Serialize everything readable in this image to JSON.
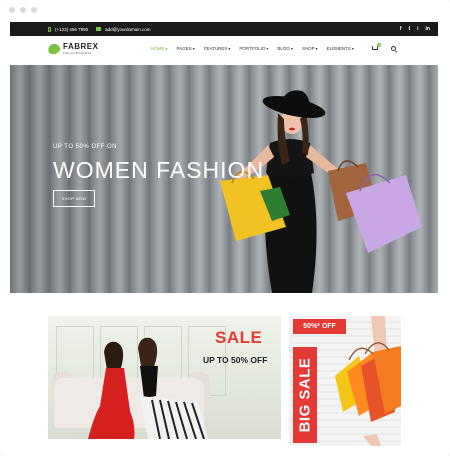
{
  "topbar": {
    "phone": "(+123) 456 7890",
    "email": "add@yourdomain.com",
    "socials": [
      "f",
      "t",
      "i",
      "in"
    ]
  },
  "logo": {
    "name": "FABREX",
    "tagline": "FOR ALL BUSINESS"
  },
  "nav": {
    "items": [
      {
        "label": "HOME",
        "active": true
      },
      {
        "label": "PAGES",
        "active": false
      },
      {
        "label": "FEATURES",
        "active": false
      },
      {
        "label": "PORTFOLIO",
        "active": false
      },
      {
        "label": "BLOG",
        "active": false
      },
      {
        "label": "SHOP",
        "active": false
      },
      {
        "label": "ELEMENTS",
        "active": false
      }
    ],
    "cart_count": "0"
  },
  "hero": {
    "subtitle": "UP TO 50% OFF ON",
    "title": "WOMEN FASHION",
    "button": "SHOP NOW"
  },
  "promo_sale": {
    "title": "SALE",
    "subtitle": "UP TO 50% OFF"
  },
  "promo_big": {
    "badge": "50%* OFF",
    "title": "BIG SALE"
  },
  "colors": {
    "accent": "#7cc242",
    "sale_red": "#e53935",
    "topbar": "#1a1a1a"
  }
}
